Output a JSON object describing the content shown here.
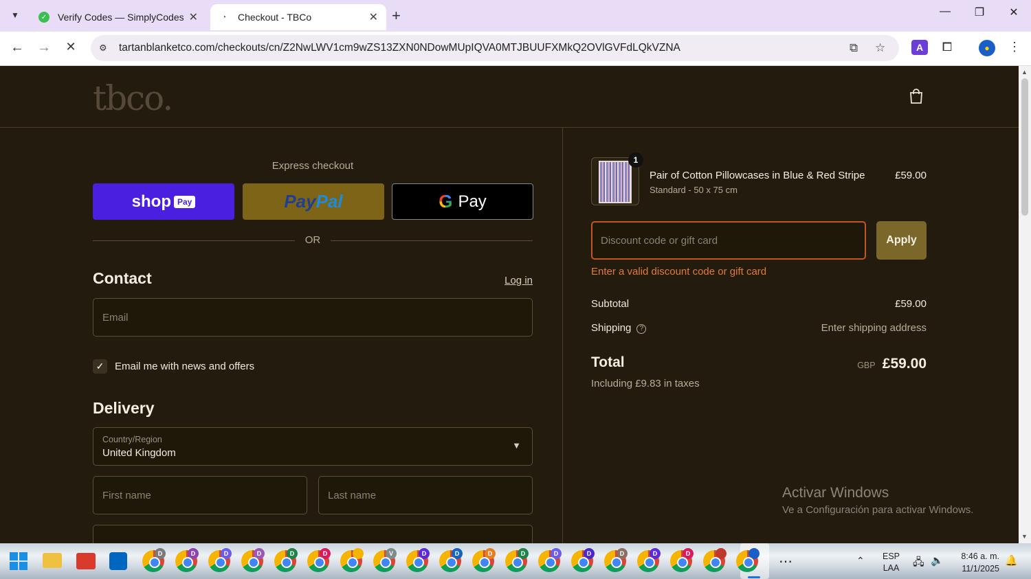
{
  "browser": {
    "tabs": [
      {
        "title": "Verify Codes — SimplyCodes",
        "active": false
      },
      {
        "title": "Checkout - TBCo",
        "active": true
      }
    ],
    "url": "tartanblanketco.com/checkouts/cn/Z2NwLWV1cm9wZS13ZXN0NDowMUpIQVA0MTJBUUFXMkQ2OVlGVFdLQkVZNA"
  },
  "header": {
    "logo_text": "tbco."
  },
  "express": {
    "title": "Express checkout",
    "shop_pay_text": "shop",
    "shop_pay_badge": "Pay",
    "paypal_pay": "Pay",
    "paypal_pal": "Pal",
    "gpay_g": "G",
    "gpay_text": "Pay",
    "or_text": "OR"
  },
  "contact": {
    "title": "Contact",
    "login_link": "Log in",
    "email_placeholder": "Email",
    "news_checked": true,
    "news_label": "Email me with news and offers"
  },
  "delivery": {
    "title": "Delivery",
    "country_label": "Country/Region",
    "country_value": "United Kingdom",
    "first_name_placeholder": "First name",
    "last_name_placeholder": "Last name"
  },
  "order": {
    "item": {
      "qty": "1",
      "name": "Pair of Cotton Pillowcases in Blue & Red Stripe",
      "variant": "Standard - 50 x 75 cm",
      "price": "£59.00"
    },
    "discount_placeholder": "Discount code or gift card",
    "apply_label": "Apply",
    "discount_error": "Enter a valid discount code or gift card",
    "subtotal_label": "Subtotal",
    "subtotal_value": "£59.00",
    "shipping_label": "Shipping",
    "shipping_value": "Enter shipping address",
    "total_label": "Total",
    "currency": "GBP",
    "total_value": "£59.00",
    "taxes_note": "Including £9.83 in taxes"
  },
  "watermark": {
    "title": "Activar Windows",
    "subtitle": "Ve a Configuración para activar Windows."
  },
  "taskbar": {
    "chrome_badges": [
      {
        "letter": "D",
        "color": "#7a7a7a"
      },
      {
        "letter": "D",
        "color": "#8e44ad"
      },
      {
        "letter": "D",
        "color": "#6c5ce7"
      },
      {
        "letter": "D",
        "color": "#9b59b6"
      },
      {
        "letter": "D",
        "color": "#1e8449"
      },
      {
        "letter": "D",
        "color": "#d81b60"
      },
      {
        "letter": "",
        "color": "#f4b400"
      },
      {
        "letter": "V",
        "color": "#7f8c8d"
      },
      {
        "letter": "D",
        "color": "#5b2bd6"
      },
      {
        "letter": "D",
        "color": "#1565c0"
      },
      {
        "letter": "D",
        "color": "#e67e22"
      },
      {
        "letter": "D",
        "color": "#1e8449"
      },
      {
        "letter": "D",
        "color": "#6c5ce7"
      },
      {
        "letter": "D",
        "color": "#4a2bc7"
      },
      {
        "letter": "D",
        "color": "#8d6e63"
      },
      {
        "letter": "D",
        "color": "#5b2bd6"
      },
      {
        "letter": "D",
        "color": "#d81b60"
      },
      {
        "letter": "",
        "color": "#c0392b"
      },
      {
        "letter": "",
        "color": "#1a5fc7"
      }
    ],
    "lang_top": "ESP",
    "lang_bottom": "LAA",
    "time": "8:46 a. m.",
    "date": "11/1/2025"
  }
}
